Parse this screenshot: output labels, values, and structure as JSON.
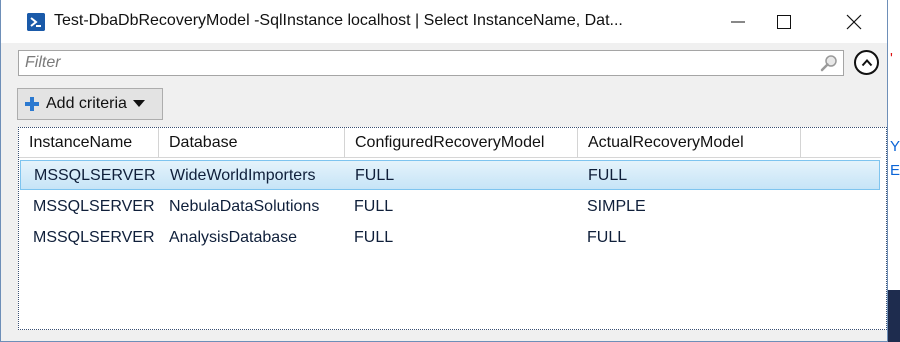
{
  "window": {
    "title": "Test-DbaDbRecoveryModel -SqlInstance localhost | Select InstanceName, Dat..."
  },
  "filter": {
    "placeholder": "Filter",
    "value": ""
  },
  "toolbar": {
    "add_criteria_label": "Add criteria"
  },
  "grid": {
    "columns": [
      "InstanceName",
      "Database",
      "ConfiguredRecoveryModel",
      "ActualRecoveryModel"
    ],
    "rows": [
      [
        "MSSQLSERVER",
        "WideWorldImporters",
        "FULL",
        "FULL"
      ],
      [
        "MSSQLSERVER",
        "NebulaDataSolutions",
        "FULL",
        "SIMPLE"
      ],
      [
        "MSSQLSERVER",
        "AnalysisDatabase",
        "FULL",
        "FULL"
      ]
    ],
    "selected_row": 0
  },
  "colors": {
    "title_icon": "#1a5aa9",
    "selection": "#c6e4f7",
    "plus_icon": "#2b79d0"
  },
  "icons": [
    "powershell-icon",
    "minimize-icon",
    "maximize-icon",
    "close-icon",
    "search-icon",
    "collapse-icon",
    "plus-icon",
    "dropdown-arrow-icon"
  ]
}
